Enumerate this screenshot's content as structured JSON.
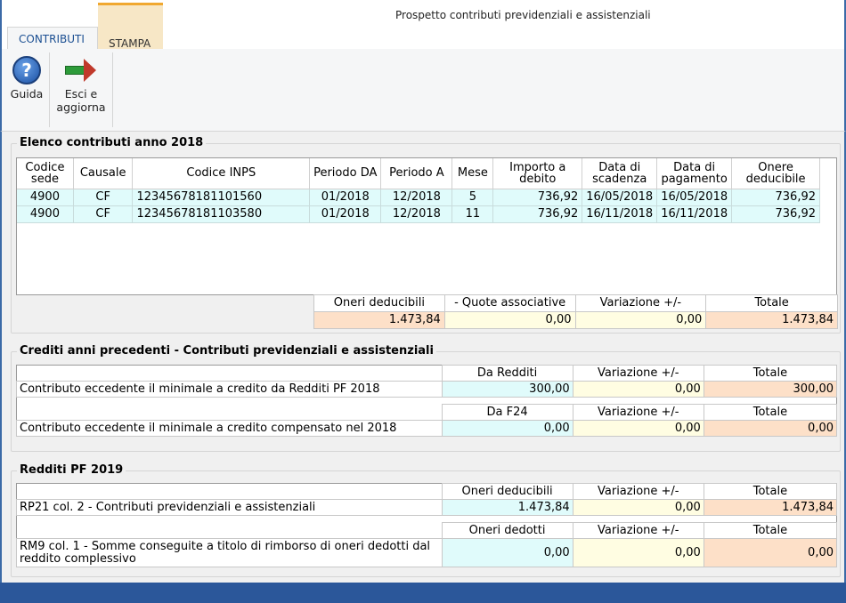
{
  "window": {
    "title": "Prospetto contributi previdenziali e assistenziali"
  },
  "tabs": {
    "contributi": "CONTRIBUTI",
    "stampa": "STAMPA"
  },
  "ribbon": {
    "guida_label": "Guida",
    "esci_label": "Esci e aggiorna"
  },
  "elenco": {
    "title": "Elenco contributi anno 2018",
    "columns": [
      "Codice sede",
      "Causale",
      "Codice INPS",
      "Periodo DA",
      "Periodo A",
      "Mese",
      "Importo a debito",
      "Data di scadenza",
      "Data di pagamento",
      "Onere deducibile"
    ],
    "rows": [
      [
        "4900",
        "CF",
        "12345678181101560",
        "01/2018",
        "12/2018",
        "5",
        "736,92",
        "16/05/2018",
        "16/05/2018",
        "736,92"
      ],
      [
        "4900",
        "CF",
        "12345678181103580",
        "01/2018",
        "12/2018",
        "11",
        "736,92",
        "16/11/2018",
        "16/11/2018",
        "736,92"
      ]
    ],
    "summary": {
      "h1": "Oneri deducibili",
      "h2": "- Quote associative",
      "h3": "Variazione +/-",
      "h4": "Totale",
      "v1": "1.473,84",
      "v2": "0,00",
      "v3": "0,00",
      "v4": "1.473,84"
    }
  },
  "crediti": {
    "title": "Crediti anni precedenti - Contributi previdenziali e assistenziali",
    "r1": {
      "h1": "Da Redditi",
      "h2": "Variazione +/-",
      "h3": "Totale",
      "label": "Contributo eccedente il minimale a credito da Redditi PF 2018",
      "v1": "300,00",
      "v2": "0,00",
      "v3": "300,00"
    },
    "r2": {
      "h1": "Da F24",
      "h2": "Variazione +/-",
      "h3": "Totale",
      "label": "Contributo eccedente il minimale a credito compensato nel 2018",
      "v1": "0,00",
      "v2": "0,00",
      "v3": "0,00"
    }
  },
  "redditi": {
    "title": "Redditi PF 2019",
    "r1": {
      "h1": "Oneri deducibili",
      "h2": "Variazione +/-",
      "h3": "Totale",
      "label": "RP21 col. 2 - Contributi previdenziali e assistenziali",
      "v1": "1.473,84",
      "v2": "0,00",
      "v3": "1.473,84"
    },
    "r2": {
      "h1": "Oneri dedotti",
      "h2": "Variazione +/-",
      "h3": "Totale",
      "label": "RM9 col. 1 - Somme conseguite a titolo di rimborso di oneri dedotti dal reddito complessivo",
      "v1": "0,00",
      "v2": "0,00",
      "v3": "0,00"
    }
  },
  "icons": {
    "guida": "help-icon",
    "esci": "exit-arrow-icon"
  }
}
